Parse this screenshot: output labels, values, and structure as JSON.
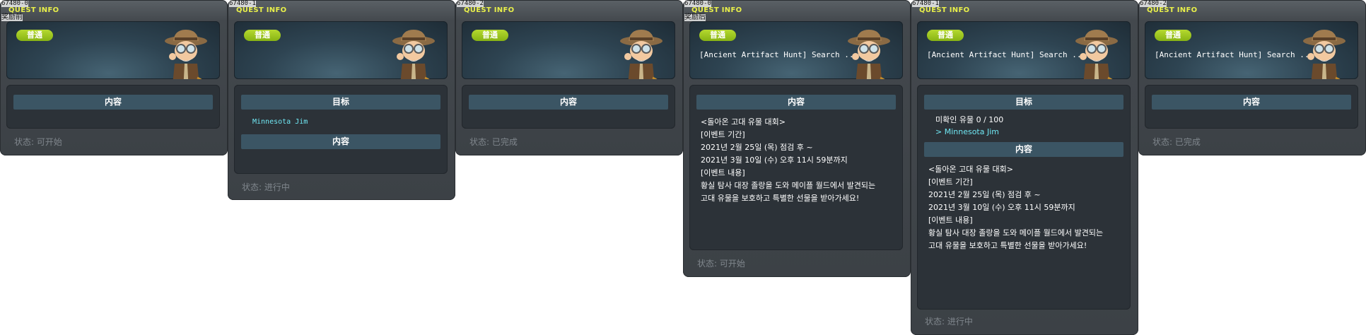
{
  "header_label": "QUEST INFO",
  "difficulty": "普通",
  "status_prefix": "状态:",
  "section_content": "内容",
  "section_goal": "目标",
  "panels": [
    {
      "id": "67480-0",
      "subtitle": "奖励前",
      "title": "",
      "status": "可开始"
    },
    {
      "id": "67480-1",
      "subtitle": "",
      "title": "",
      "npc_link": "Minnesota Jim",
      "status": "进行中"
    },
    {
      "id": "67480-2",
      "subtitle": "",
      "title": "",
      "status": "已完成"
    },
    {
      "id": "67480-0",
      "subtitle": "奖励后",
      "title": "[Ancient Artifact Hunt] Search ..",
      "status": "可开始"
    },
    {
      "id": "67480-1",
      "subtitle": "",
      "title": "[Ancient Artifact Hunt] Search ..",
      "progress": "미확인 유물 0 / 100",
      "npc_link": "> Minnesota Jim",
      "status": "进行中"
    },
    {
      "id": "67480-2",
      "subtitle": "",
      "title": "[Ancient Artifact Hunt] Search ..",
      "status": "已完成"
    }
  ],
  "content_lines": [
    "<돌아온 고대 유물 대회>",
    "",
    "[이벤트 기간]",
    "2021년 2월 25일 (목) 점검 후 ~",
    "2021년 3월 10일 (수) 오후 11시 59분까지",
    "",
    "[이벤트 내용]",
    "황실 탐사 대장 졸랑을 도와 메이플 월드에서 발견되는",
    "고대 유물을 보호하고 특별한 선물을 받아가세요!"
  ]
}
